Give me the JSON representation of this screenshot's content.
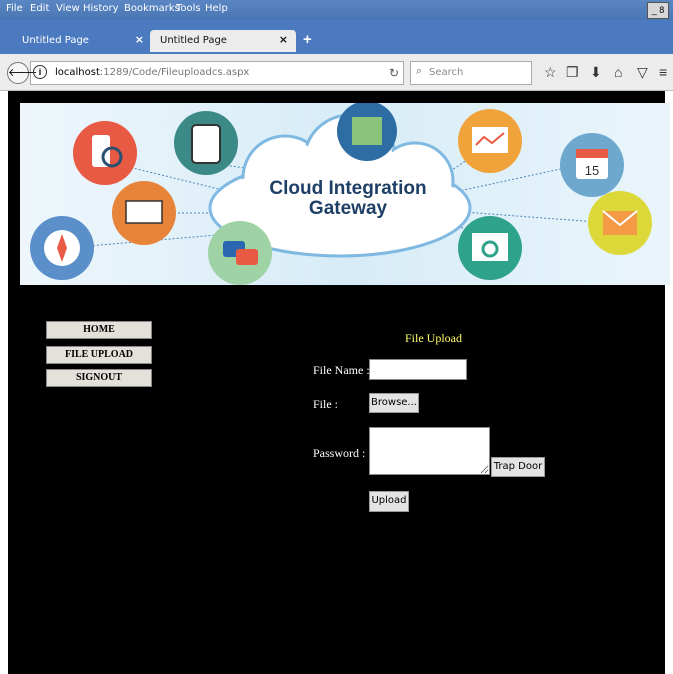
{
  "menubar": {
    "items": [
      "File",
      "Edit",
      "View",
      "History",
      "Bookmarks",
      "Tools",
      "Help"
    ],
    "restore_glyph": "_ 8"
  },
  "tabs": [
    {
      "label": "Untitled Page",
      "close": "×"
    },
    {
      "label": "Untitled Page",
      "close": "×"
    }
  ],
  "newtab_glyph": "+",
  "nav": {
    "url_host": "localhost",
    "url_path": ":1289/Code/Fileuploadcs.aspx",
    "search_placeholder": "Search"
  },
  "icons": {
    "back": "back-arrow-icon",
    "info": "info-icon",
    "reload": "reload-icon",
    "search": "search-icon",
    "bookmark": "star-icon",
    "reader": "clipboard-icon",
    "download": "download-icon",
    "home": "home-icon",
    "pocket": "pocket-icon",
    "menu": "hamburger-menu-icon"
  },
  "banner": {
    "title_line1": "Cloud Integration",
    "title_line2": "Gateway",
    "calendar_day": "15"
  },
  "sidemenu": [
    "HOME",
    "FILE UPLOAD",
    "SIGNOUT"
  ],
  "form": {
    "title": "File Upload",
    "filename_label": "File Name :",
    "file_label": "File :",
    "browse_button": "Browse...",
    "password_label": "Password :",
    "trapdoor_button": "Trap Door",
    "upload_button": "Upload"
  },
  "colors": {
    "page_background": "#000000",
    "form_title": "#ffff66",
    "tab_strip": "#4b7ac0"
  }
}
